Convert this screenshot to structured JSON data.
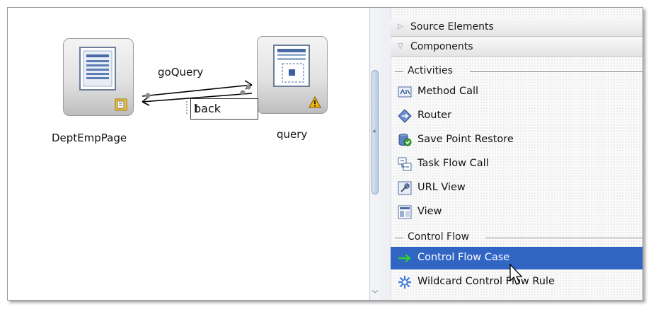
{
  "diagram": {
    "nodes": [
      {
        "id": "dept",
        "label": "DeptEmpPage"
      },
      {
        "id": "query",
        "label": "query"
      }
    ],
    "edges": [
      {
        "label": "goQuery"
      },
      {
        "label": "back",
        "editing": true
      }
    ]
  },
  "palette": {
    "headers": [
      {
        "label": "Source Elements",
        "expanded": false
      },
      {
        "label": "Components",
        "expanded": true
      }
    ],
    "sections": [
      {
        "label": "Activities",
        "items": [
          {
            "label": "Method Call",
            "icon": "method-call-icon"
          },
          {
            "label": "Router",
            "icon": "router-icon"
          },
          {
            "label": "Save Point Restore",
            "icon": "save-point-restore-icon"
          },
          {
            "label": "Task Flow Call",
            "icon": "task-flow-call-icon"
          },
          {
            "label": "URL View",
            "icon": "url-view-icon"
          },
          {
            "label": "View",
            "icon": "view-icon"
          }
        ]
      },
      {
        "label": "Control Flow",
        "items": [
          {
            "label": "Control Flow Case",
            "icon": "green-arrow-icon",
            "selected": true
          },
          {
            "label": "Wildcard Control Flow Rule",
            "icon": "wildcard-icon"
          }
        ]
      }
    ]
  },
  "colors": {
    "selection": "#3165c4",
    "edge": "#000000",
    "warning": "#f2b705"
  }
}
